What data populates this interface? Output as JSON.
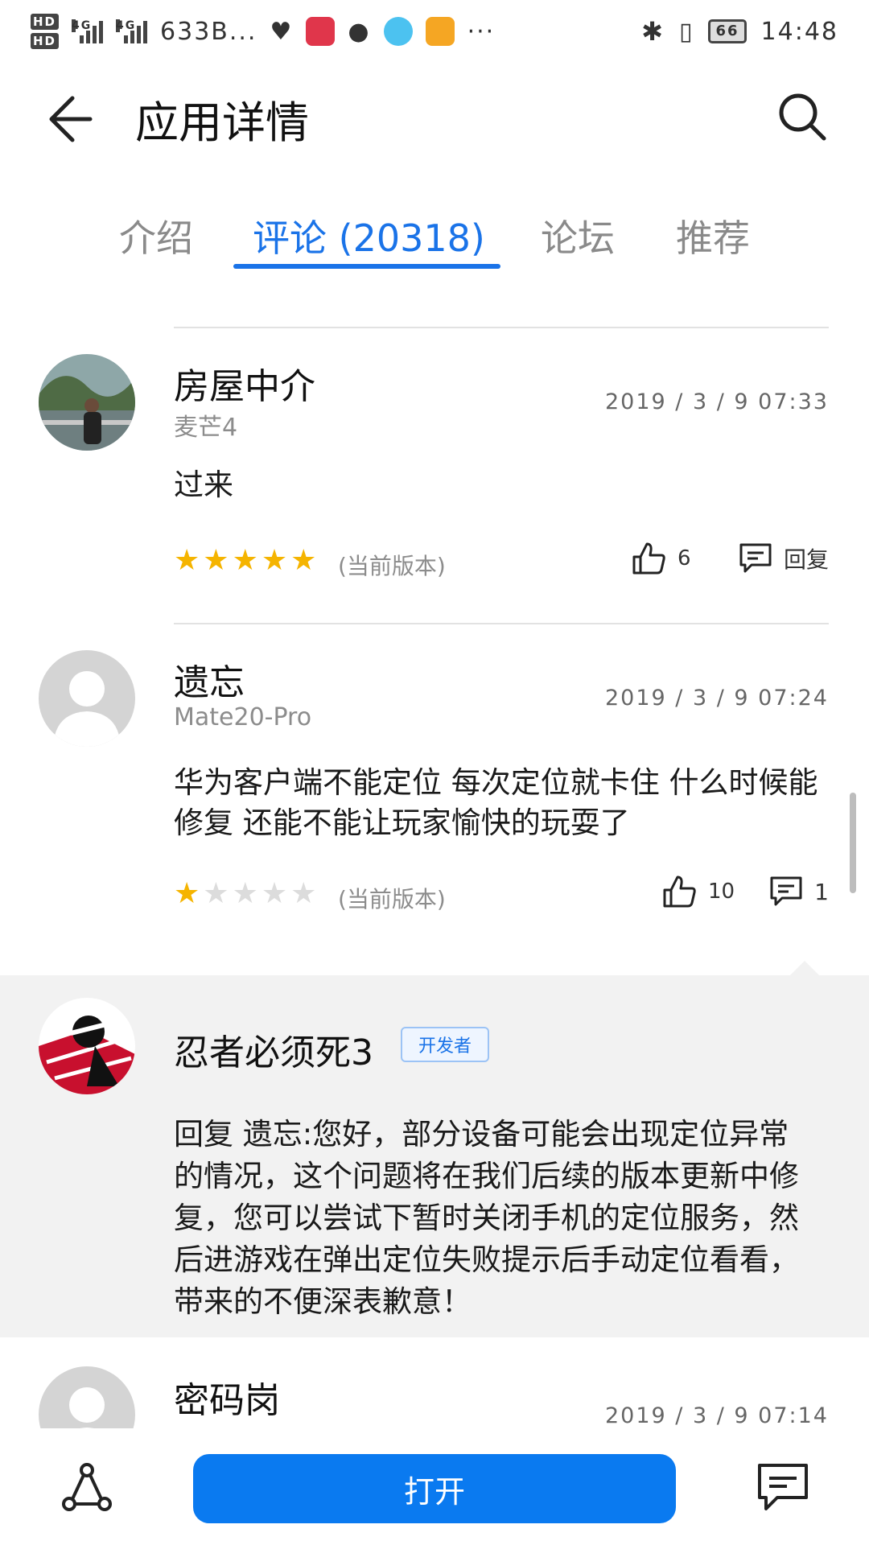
{
  "status_bar": {
    "hd1": "HD",
    "hd2": "HD",
    "net1": "4G",
    "net2": "4G",
    "speed": "633B...",
    "more": "···",
    "time": "14:48",
    "battery": "66"
  },
  "header": {
    "title": "应用详情"
  },
  "tabs": [
    {
      "label": "介绍",
      "active": false
    },
    {
      "label": "评论 (20318)",
      "active": true
    },
    {
      "label": "论坛",
      "active": false
    },
    {
      "label": "推荐",
      "active": false
    }
  ],
  "reviews": [
    {
      "name": "房屋中介",
      "device": "麦芒4",
      "time": "2019 / 3 / 9 07:33",
      "text": "过来",
      "stars": 5,
      "version": "(当前版本)",
      "likes": "6",
      "reply_label": "回复"
    },
    {
      "name": "遗忘",
      "device": "Mate20-Pro",
      "time": "2019 / 3 / 9 07:24",
      "text": "华为客户端不能定位 每次定位就卡住 什么时候能修复 还能不能让玩家愉快的玩耍了",
      "stars": 1,
      "version": "(当前版本)",
      "likes": "10",
      "replies": "1"
    },
    {
      "name": "密码岗",
      "device": "",
      "time": "2019 / 3 / 9 07:14"
    }
  ],
  "developer_reply": {
    "name": "忍者必须死3",
    "badge": "开发者",
    "text": "回复 遗忘:您好，部分设备可能会出现定位异常的情况，这个问题将在我们后续的版本更新中修复，您可以尝试下暂时关闭手机的定位服务，然后进游戏在弹出定位失败提示后手动定位看看，带来的不便深表歉意！"
  },
  "bottom_bar": {
    "open_label": "打开"
  },
  "colors": {
    "accent": "#1a73e8",
    "open_button": "#0a7af0",
    "star": "#f5b400",
    "dev_reply_bg": "#f2f2f2"
  }
}
